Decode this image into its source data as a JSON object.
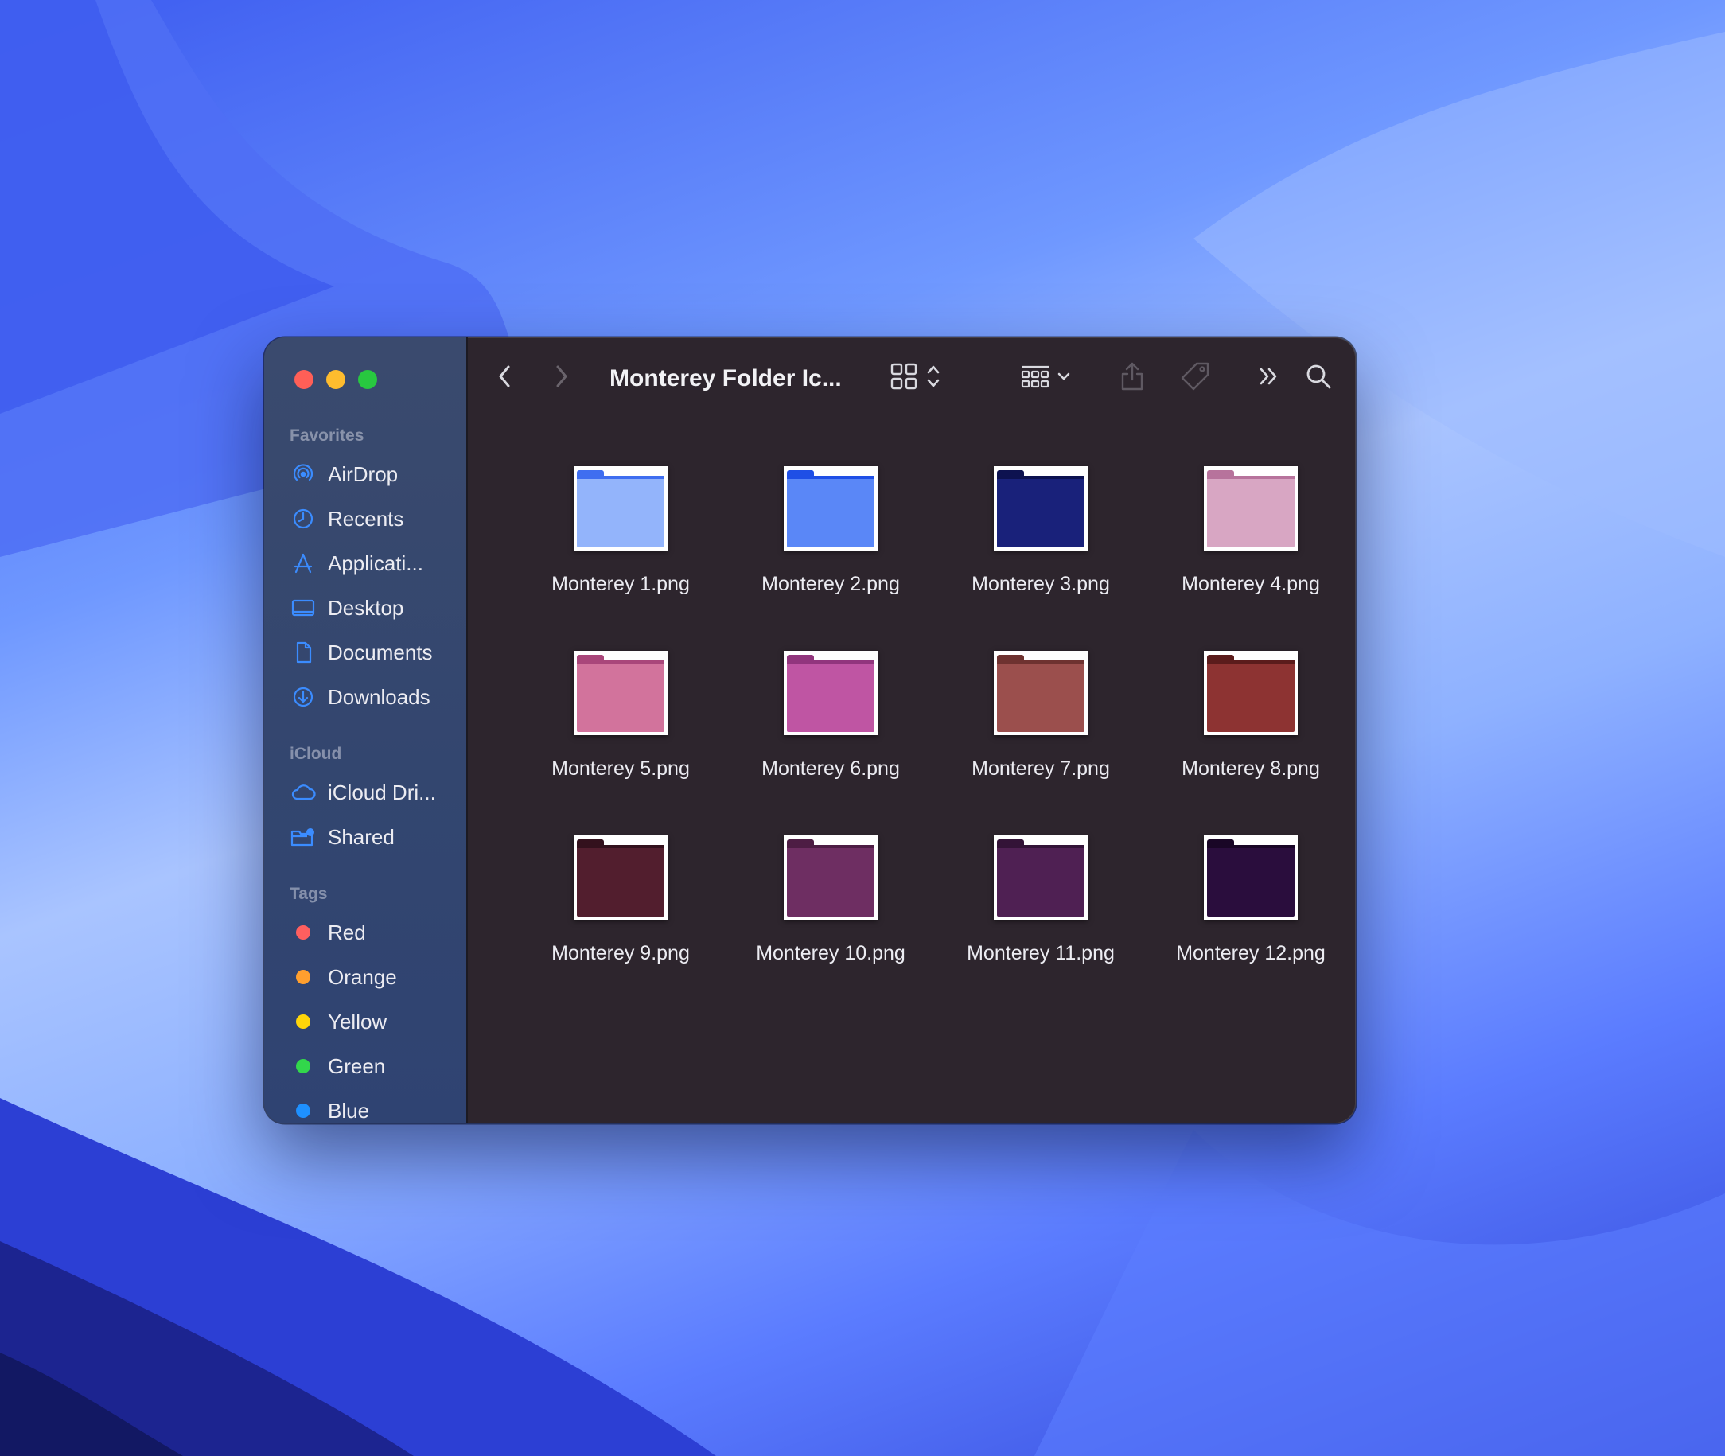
{
  "window": {
    "title": "Monterey Folder Ic..."
  },
  "sidebar": {
    "sections": {
      "favorites": "Favorites",
      "icloud": "iCloud",
      "tags": "Tags"
    },
    "favorites": [
      {
        "label": "AirDrop",
        "icon": "airdrop-icon"
      },
      {
        "label": "Recents",
        "icon": "clock-icon"
      },
      {
        "label": "Applicati...",
        "icon": "applications-icon"
      },
      {
        "label": "Desktop",
        "icon": "desktop-icon"
      },
      {
        "label": "Documents",
        "icon": "document-icon"
      },
      {
        "label": "Downloads",
        "icon": "download-icon"
      }
    ],
    "icloud": [
      {
        "label": "iCloud Dri...",
        "icon": "cloud-icon"
      },
      {
        "label": "Shared",
        "icon": "shared-folder-icon"
      }
    ],
    "tags": [
      {
        "label": "Red",
        "color": "#ff5f5f"
      },
      {
        "label": "Orange",
        "color": "#ff9f2e"
      },
      {
        "label": "Yellow",
        "color": "#ffd60a"
      },
      {
        "label": "Green",
        "color": "#32d74b"
      },
      {
        "label": "Blue",
        "color": "#1e90ff"
      }
    ]
  },
  "accent": "#3b8cff",
  "files": [
    {
      "name": "Monterey 1.png",
      "color": "#93b4fb",
      "tab": "#3f6ef0"
    },
    {
      "name": "Monterey 2.png",
      "color": "#5a87f7",
      "tab": "#1f4fe6"
    },
    {
      "name": "Monterey 3.png",
      "color": "#19217a",
      "tab": "#0d1250"
    },
    {
      "name": "Monterey 4.png",
      "color": "#d8a6c3",
      "tab": "#b7739c"
    },
    {
      "name": "Monterey 5.png",
      "color": "#d2739c",
      "tab": "#a9467a"
    },
    {
      "name": "Monterey 6.png",
      "color": "#bf55a3",
      "tab": "#91357d"
    },
    {
      "name": "Monterey 7.png",
      "color": "#9b4f4d",
      "tab": "#6e3230"
    },
    {
      "name": "Monterey 8.png",
      "color": "#8d3332",
      "tab": "#5b1c1c"
    },
    {
      "name": "Monterey 9.png",
      "color": "#521e2e",
      "tab": "#33111d"
    },
    {
      "name": "Monterey 10.png",
      "color": "#6e2e62",
      "tab": "#4d1d44"
    },
    {
      "name": "Monterey 11.png",
      "color": "#4f2053",
      "tab": "#331337"
    },
    {
      "name": "Monterey 12.png",
      "color": "#2a0d3d",
      "tab": "#190626"
    }
  ]
}
